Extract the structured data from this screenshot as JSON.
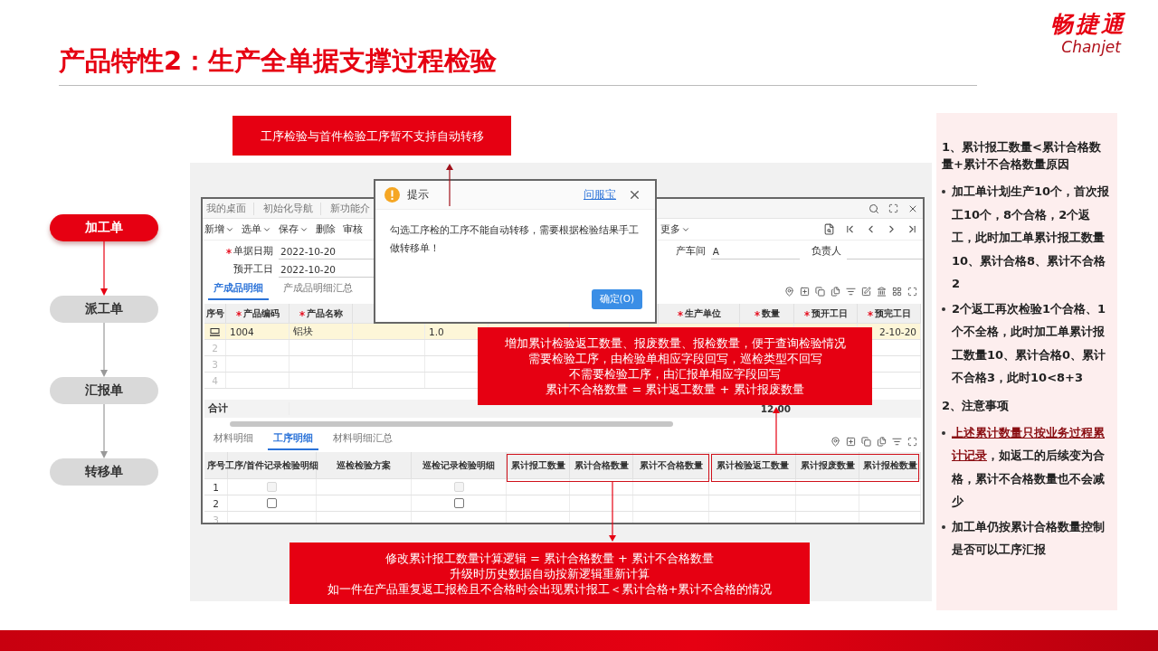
{
  "title": "产品特性2：生产全单据支撑过程检验",
  "logo": {
    "name": "畅捷通",
    "sub": "Chanjet"
  },
  "flow": [
    {
      "label": "加工单",
      "selected": true
    },
    {
      "label": "派工单",
      "selected": false
    },
    {
      "label": "汇报单",
      "selected": false
    },
    {
      "label": "转移单",
      "selected": false
    }
  ],
  "app": {
    "nav_tabs": [
      "我的桌面",
      "初始化导航",
      "新功能介"
    ],
    "toolbar": [
      {
        "label": "新增",
        "dropdown": true
      },
      {
        "label": "选单",
        "dropdown": true
      },
      {
        "label": "保存",
        "dropdown": true
      },
      {
        "label": "删除",
        "dropdown": false
      },
      {
        "label": "审核",
        "dropdown": false
      },
      {
        "label": "更多",
        "dropdown": true
      }
    ],
    "fields": [
      {
        "label": "单据日期",
        "required": true,
        "value": "2022-10-20"
      },
      {
        "label": "预开工日",
        "required": false,
        "value": "2022-10-20"
      },
      {
        "label": "产车间",
        "required": false,
        "value": "A"
      },
      {
        "label": "负责人",
        "required": false
      }
    ],
    "upper_tabs": [
      {
        "label": "产成品明细",
        "selected": true
      },
      {
        "label": "产成品明细汇总",
        "selected": false
      }
    ],
    "upper_table": {
      "columns": [
        {
          "label": "序号",
          "required": false
        },
        {
          "label": "产品编码",
          "required": true
        },
        {
          "label": "产品名称",
          "required": true
        },
        {},
        {},
        {},
        {},
        {
          "label": "生产单位",
          "required": true
        },
        {
          "label": "数量",
          "required": true
        },
        {
          "label": "预开工日",
          "required": true
        },
        {
          "label": "预完工日",
          "required": true
        }
      ],
      "rows": [
        {
          "selected": true,
          "code": "1004",
          "name": "铝块",
          "column_5": "1.0",
          "end_date": "2-10-20"
        },
        {
          "selected": false,
          "no": "2"
        },
        {
          "selected": false,
          "no": "3"
        },
        {
          "selected": false,
          "no": "4"
        }
      ],
      "total_label": "合计",
      "total_quantity": "12.00"
    },
    "lower_tabs": [
      {
        "label": "材料明细",
        "selected": false
      },
      {
        "label": "工序明细",
        "selected": true
      },
      {
        "label": "材料明细汇总",
        "selected": false
      }
    ],
    "lower_table": {
      "columns": [
        "序号",
        "工序/首件记录检验明细",
        "巡检检验方案",
        "巡检记录检验明细",
        "累计报工数量",
        "累计合格数量",
        "累计不合格数量",
        "累计检验返工数量",
        "累计报废数量",
        "累计报检数量"
      ],
      "rows": [
        {
          "no": "1",
          "first_piece": {
            "checked": false,
            "disabled": true
          },
          "patrol_record": {
            "checked": false,
            "disabled": true
          }
        },
        {
          "no": "2",
          "first_piece": {
            "checked": false,
            "disabled": false
          },
          "patrol_record": {
            "checked": false,
            "disabled": false
          }
        },
        {
          "no": "3"
        }
      ]
    }
  },
  "dialog": {
    "title": "提示",
    "help_link": "问服宝",
    "message": "勾选工序检的工序不能自动转移，需要根据检验结果手工做转移单！",
    "ok": "确定(O)"
  },
  "callouts": [
    {
      "lines": [
        "工序检验与首件检验工序暂不支持自动转移"
      ]
    },
    {
      "lines": [
        "增加累计检验返工数量、报废数量、报检数量，便于查询检验情况",
        "需要检验工序，由检验单相应字段回写，巡检类型不回写",
        "不需要检验工序，由汇报单相应字段回写",
        "累计不合格数量 = 累计返工数量 + 累计报废数量"
      ]
    },
    {
      "lines": [
        "修改累计报工数量计算逻辑 = 累计合格数量 + 累计不合格数量",
        "升级时历史数据自动按新逻辑重新计算",
        "如一件在产品重复返工报检且不合格时会出现累计报工＜累计合格+累计不合格的情况"
      ]
    }
  ],
  "notes": [
    {
      "heading": "1、累计报工数量<累计合格数量+累计不合格数量原因",
      "items": [
        {
          "text": "加工单计划生产10个，首次报工10个，8个合格，2个返工，此时加工单累计报工数量10、累计合格8、累计不合格2"
        },
        {
          "text": "2个返工再次检验1个合格、1个不全格，此时加工单累计报工数量10、累计合格0、累计不合格3，此时10<8+3"
        }
      ]
    },
    {
      "heading": "2、注意事项",
      "items": [
        {
          "highlight": "上述累计数量只按业务过程累计记录",
          "text": "，如返工的后续变为合格，累计不合格数量也不会减少"
        },
        {
          "text": "加工单仍按累计合格数量控制是否可以工序汇报"
        }
      ]
    }
  ]
}
